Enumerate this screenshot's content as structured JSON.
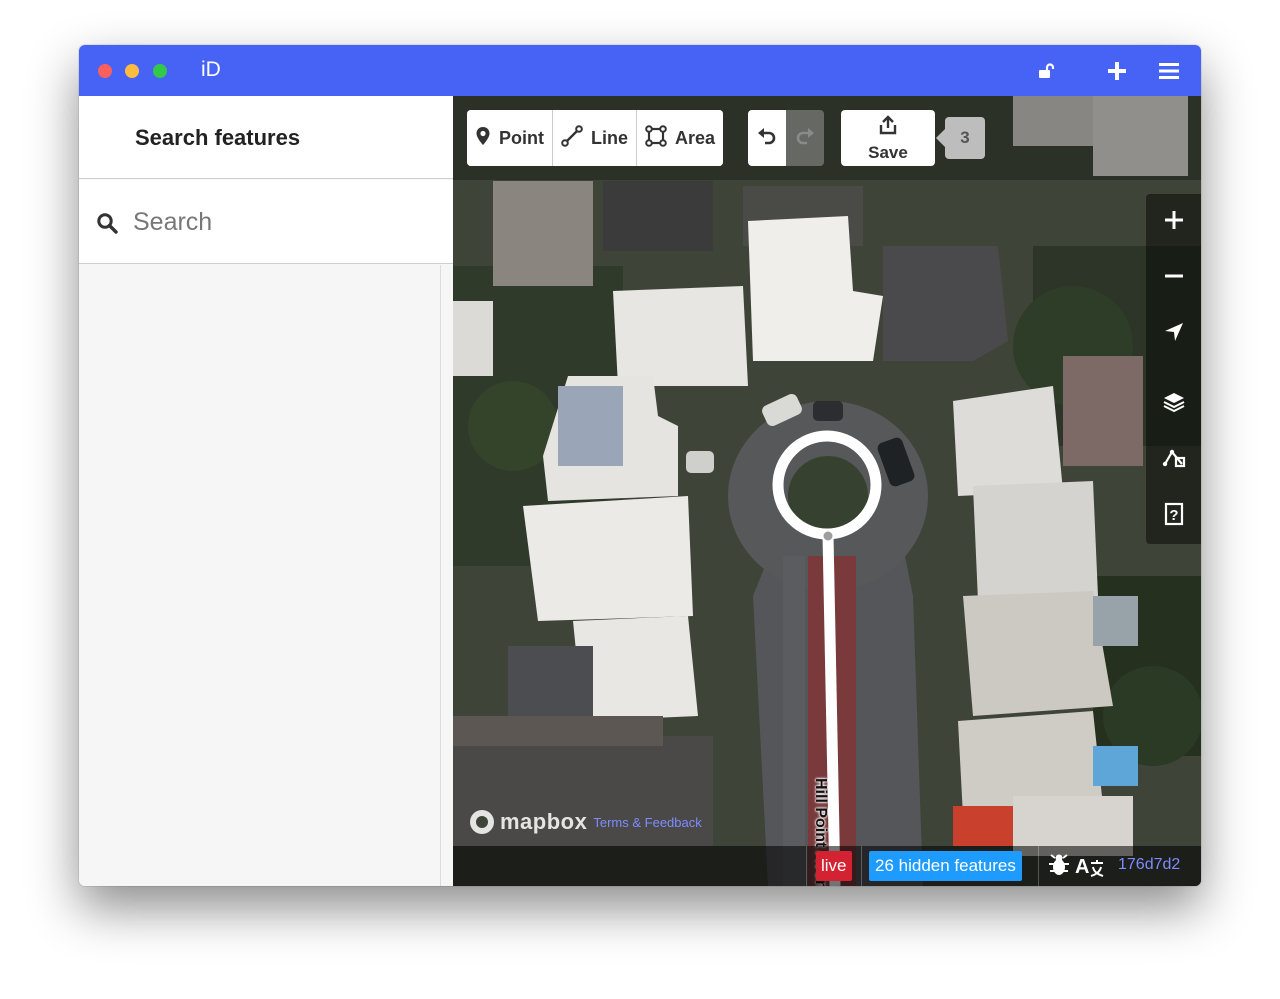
{
  "window": {
    "title": "iD"
  },
  "titlebar": {
    "icons": [
      "lock-open-icon",
      "plus-icon",
      "hamburger-menu-icon"
    ]
  },
  "sidebar": {
    "title": "Search features",
    "search": {
      "placeholder": "Search",
      "value": ""
    }
  },
  "toolbar": {
    "modes": [
      {
        "label": "Point",
        "icon": "map-marker-icon"
      },
      {
        "label": "Line",
        "icon": "line-icon"
      },
      {
        "label": "Area",
        "icon": "area-icon"
      }
    ],
    "undo_icon": "undo-icon",
    "redo_icon": "redo-icon",
    "save_label": "Save",
    "save_icon": "share-upload-icon",
    "edit_count": "3"
  },
  "map_controls": [
    "zoom-in-icon",
    "zoom-out-icon",
    "geolocate-icon",
    "layers-icon",
    "map-data-icon",
    "help-icon"
  ],
  "map": {
    "road_label": "Hill Point Avenu",
    "attribution": {
      "logo": "mapbox",
      "link": "Terms & Feedback"
    }
  },
  "footer": {
    "live_badge": "live",
    "hidden_features": "26 hidden features",
    "icons": [
      "bug-icon",
      "translate-icon"
    ],
    "translate_label": "A",
    "version": "176d7d2"
  },
  "colors": {
    "titlebar": "#4663f5",
    "live": "#d32232",
    "hidden_features": "#1e9bff",
    "link": "#7c8cff"
  }
}
